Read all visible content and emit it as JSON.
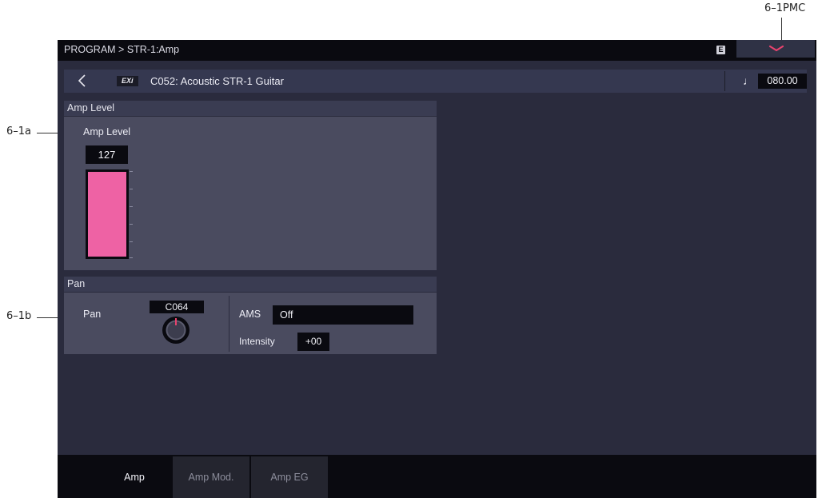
{
  "callouts": {
    "pmc": "6–1PMC",
    "amp_level": "6–1a",
    "pan": "6–1b"
  },
  "header": {
    "breadcrumb": "PROGRAM > STR-1:Amp",
    "edit_badge": "E",
    "pmc_icon": "chevron-down-icon"
  },
  "program": {
    "back_icon": "back-arrow-icon",
    "engine_tag": "EXi",
    "name": "C052: Acoustic STR-1 Guitar",
    "tempo_icon": "quarter-note-icon",
    "tempo": "080.00"
  },
  "amp_level": {
    "section_title": "Amp Level",
    "label": "Amp Level",
    "value": "127",
    "level_fraction": 1.0
  },
  "pan": {
    "section_title": "Pan",
    "label": "Pan",
    "value": "C064",
    "ams_label": "AMS",
    "ams_value": "Off",
    "intensity_label": "Intensity",
    "intensity_value": "+00"
  },
  "tabs": [
    {
      "label": "Amp",
      "active": true
    },
    {
      "label": "Amp Mod.",
      "active": false
    },
    {
      "label": "Amp EG",
      "active": false
    }
  ],
  "colors": {
    "accent_pink": "#ee62a4",
    "knob_indicator": "#e8436e",
    "screen_bg": "#2a2b3d"
  }
}
